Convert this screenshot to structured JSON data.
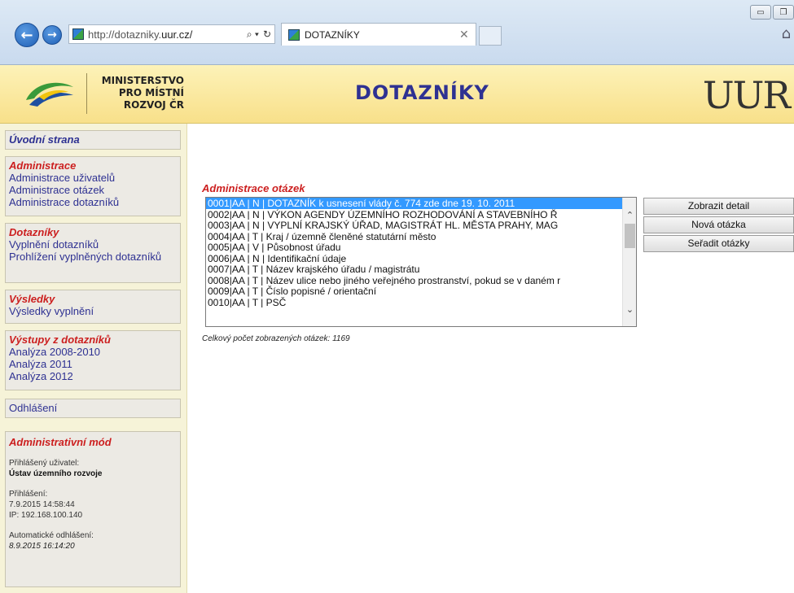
{
  "browser": {
    "url_prefix": "http://dotazniky.",
    "url_domain": "uur.cz/",
    "tab_title": "DOTAZNÍKY"
  },
  "header": {
    "ministry_lines": [
      "MINISTERSTVO",
      "PRO MÍSTNÍ",
      "ROZVOJ ČR"
    ],
    "app_title": "DOTAZNÍKY",
    "logo_text": "UUR"
  },
  "sidebar": {
    "home": "Úvodní strana",
    "admin": {
      "title": "Administrace",
      "items": [
        "Administrace uživatelů",
        "Administrace otázek",
        "Administrace dotazníků"
      ]
    },
    "questionnaires": {
      "title": "Dotazníky",
      "items": [
        "Vyplnění dotazníků",
        "Prohlížení vyplněných dotazníků"
      ]
    },
    "results": {
      "title": "Výsledky",
      "items": [
        "Výsledky vyplnění"
      ]
    },
    "outputs": {
      "title": "Výstupy z dotazníků",
      "items": [
        "Analýza 2008-2010",
        "Analýza 2011",
        "Analýza 2012"
      ]
    },
    "logout": "Odhlášení",
    "admin_mode": {
      "title": "Administrativní mód",
      "user_label": "Přihlášený uživatel:",
      "user_value": "Ústav územního rozvoje",
      "login_label": "Přihlášení:",
      "login_time": "7.9.2015 14:58:44",
      "ip": "IP: 192.168.100.140",
      "auto_logout_label": "Automatické odhlášení:",
      "auto_logout_time": "8.9.2015 16:14:20"
    }
  },
  "main": {
    "section_title": "Administrace otázek",
    "rows": [
      "0001|AA | N | DOTAZNÍK k usnesení vlády č. 774 zde dne 19. 10. 2011",
      "0002|AA | N | VÝKON AGENDY ÚZEMNÍHO ROZHODOVÁNÍ A STAVEBNÍHO Ř",
      "0003|AA | N | VYPLNÍ KRAJSKÝ ÚŘAD, MAGISTRÁT HL. MĚSTA PRAHY, MAG",
      "0004|AA | T | Kraj / územně členěné statutární město",
      "0005|AA | V | Působnost úřadu",
      "0006|AA | N | Identifikační údaje",
      "0007|AA | T | Název krajského úřadu / magistrátu",
      "0008|AA | T | Název ulice nebo jiného veřejného prostranství, pokud se v daném r",
      "0009|AA | T | Číslo popisné / orientační",
      "0010|AA | T | PSČ"
    ],
    "selected_index": 0,
    "count_text": "Celkový počet zobrazených otázek: 1169",
    "buttons": [
      "Zobrazit detail",
      "Nová otázka",
      "Seřadit otázky"
    ]
  }
}
